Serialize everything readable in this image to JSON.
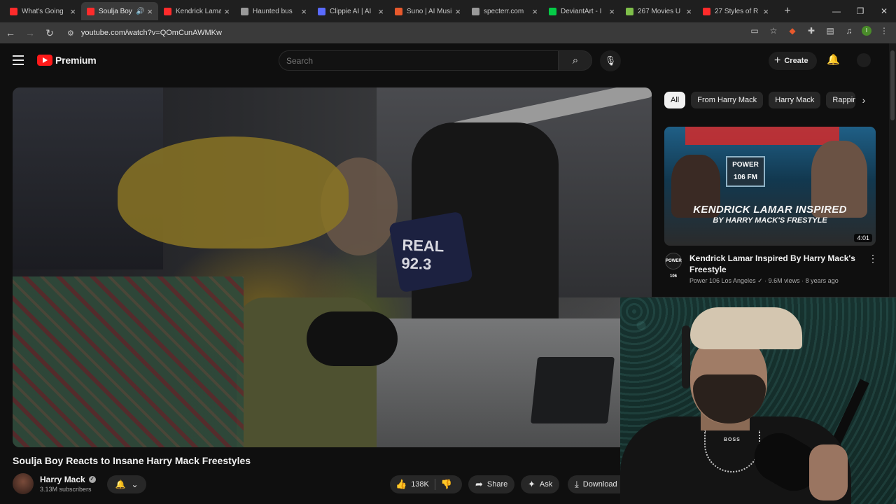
{
  "browser": {
    "tabs": [
      {
        "title": "What's Going",
        "favicon_color": "#ff2b2b",
        "active": false
      },
      {
        "title": "Soulja Boy",
        "favicon_color": "#ff2b2b",
        "active": true,
        "audio": true
      },
      {
        "title": "Kendrick Lama",
        "favicon_color": "#ff2b2b",
        "active": false
      },
      {
        "title": "Haunted bus",
        "favicon_color": "#9a9a9a",
        "active": false
      },
      {
        "title": "Clippie AI | AI",
        "favicon_color": "#5a6bff",
        "active": false
      },
      {
        "title": "Suno | AI Musi",
        "favicon_color": "#e8592c",
        "active": false
      },
      {
        "title": "specterr.com",
        "favicon_color": "#9a9a9a",
        "active": false
      },
      {
        "title": "DeviantArt - I",
        "favicon_color": "#05cc47",
        "active": false
      },
      {
        "title": "267 Movies U",
        "favicon_color": "#7fbf4a",
        "active": false
      },
      {
        "title": "27 Styles of R",
        "favicon_color": "#ff2b2b",
        "active": false
      }
    ],
    "url": "youtube.com/watch?v=QOmCunAWMKw",
    "profile_initial": "I"
  },
  "youtube": {
    "logo_text": "Premium",
    "search_placeholder": "Search",
    "create_label": "Create"
  },
  "video": {
    "title": "Soulja Boy Reacts to Insane Harry Mack Freestyles",
    "channel": "Harry Mack",
    "subscribers": "3.13M subscribers",
    "likes": "138K",
    "share_label": "Share",
    "ask_label": "Ask",
    "download_label": "Download",
    "scene_sign_text": "REAL 92.3"
  },
  "sidebar": {
    "chips": [
      "All",
      "From Harry Mack",
      "Harry Mack",
      "Rappin"
    ],
    "recommendations": [
      {
        "thumb_caption_1": "KENDRICK LAMAR INSPIRED",
        "thumb_caption_2": "BY HARRY MACK'S FRESTYLE",
        "thumb_station": "POWER 106 FM",
        "duration": "4:01",
        "title": "Kendrick Lamar Inspired By Harry Mack's Freestyle",
        "channel": "Power 106 Los Angeles",
        "views": "9.6M views",
        "age": "8 years ago",
        "channel_avatar_text": "POWER 106"
      }
    ]
  },
  "webcam": {
    "shirt_brand": "BOSS"
  }
}
